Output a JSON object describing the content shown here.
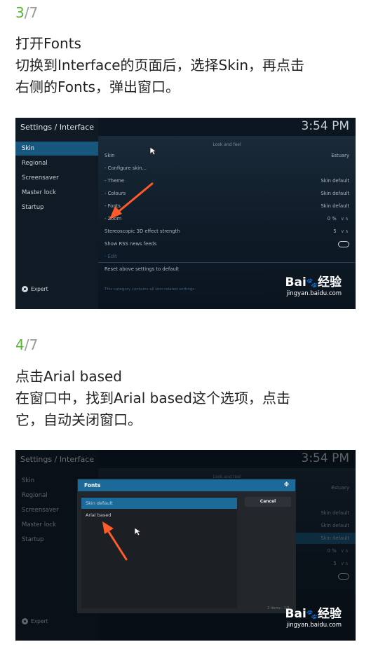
{
  "step3": {
    "current": "3",
    "total": "/7",
    "title": "打开Fonts",
    "line1": "切换到Interface的页面后，选择Skin，再点击",
    "line2": "右侧的Fonts，弹出窗口。"
  },
  "step4": {
    "current": "4",
    "total": "/7",
    "title": "点击Arial based",
    "line1": "在窗口中，找到Arial based这个选项，点击",
    "line2": "它，自动关闭窗口。"
  },
  "screen": {
    "breadcrumb": "Settings / Interface",
    "time": "3:54 PM",
    "sidebar": [
      "Skin",
      "Regional",
      "Screensaver",
      "Master lock",
      "Startup"
    ],
    "expert_label": "Expert",
    "section_header": "Look and feel",
    "rows": [
      {
        "label": "Skin",
        "value": "Estuary"
      },
      {
        "label": "- Configure skin...",
        "value": ""
      },
      {
        "label": "- Theme",
        "value": "Skin default"
      },
      {
        "label": "- Colours",
        "value": "Skin default"
      },
      {
        "label": "- Fonts",
        "value": "Skin default"
      },
      {
        "label": "- Zoom",
        "value": "0 %"
      },
      {
        "label": "Stereoscopic 3D effect strength",
        "value": "5"
      },
      {
        "label": "Show RSS news feeds",
        "value": ""
      },
      {
        "label": "- Edit",
        "value": ""
      }
    ],
    "reset_label": "Reset above settings to default",
    "hint": "This category contains all skin related settings."
  },
  "dialog": {
    "title": "Fonts",
    "options": [
      "Skin default",
      "Arial based"
    ],
    "cancel": "Cancel",
    "count": "2 items - 1/1"
  },
  "watermark": {
    "brand_a": "Bai",
    "brand_b": "经验",
    "url": "jingyan.baidu.com"
  }
}
